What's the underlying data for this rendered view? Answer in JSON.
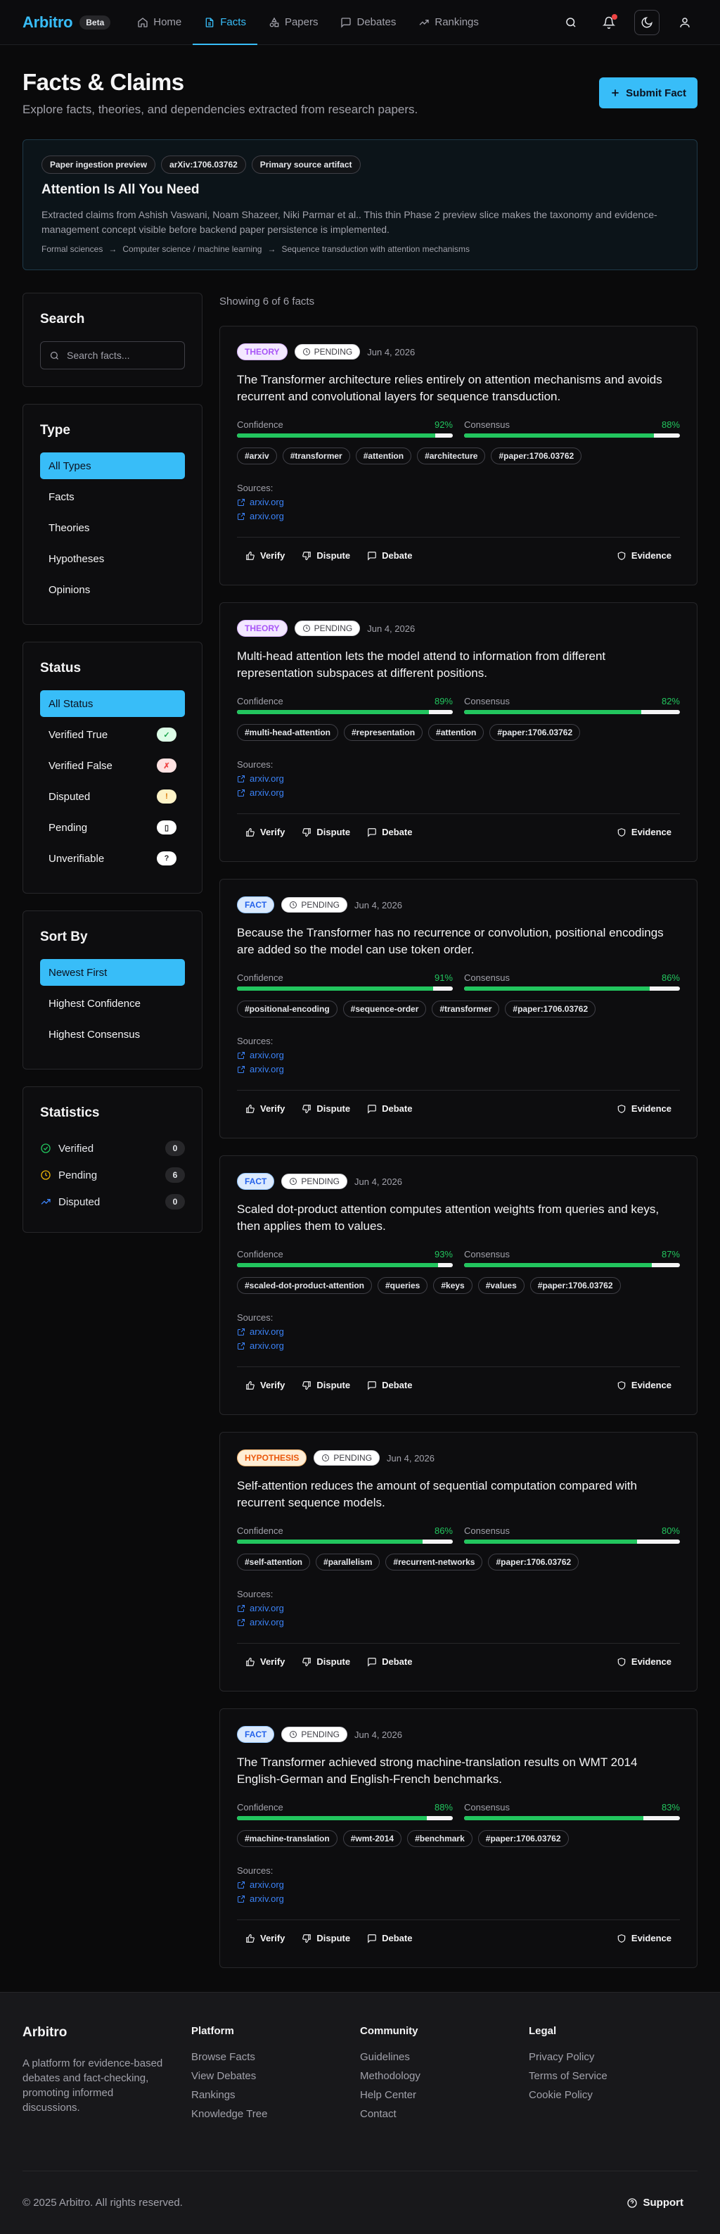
{
  "nav": {
    "brand": "Arbitro",
    "beta": "Beta",
    "links": [
      {
        "label": "Home",
        "icon": "home-icon"
      },
      {
        "label": "Facts",
        "icon": "document-icon",
        "active": true
      },
      {
        "label": "Papers",
        "icon": "shapes-icon"
      },
      {
        "label": "Debates",
        "icon": "chat-icon"
      },
      {
        "label": "Rankings",
        "icon": "trending-icon"
      }
    ]
  },
  "header": {
    "title": "Facts & Claims",
    "subtitle": "Explore facts, theories, and dependencies extracted from research papers.",
    "submit_label": "Submit Fact"
  },
  "preview": {
    "chips": [
      "Paper ingestion preview",
      "arXiv:1706.03762",
      "Primary source artifact"
    ],
    "title": "Attention Is All You Need",
    "description": "Extracted claims from Ashish Vaswani, Noam Shazeer, Niki Parmar et al.. This thin Phase 2 preview slice makes the taxonomy and evidence-management concept visible before backend paper persistence is implemented.",
    "crumbs": [
      "Formal sciences",
      "Computer science / machine learning",
      "Sequence transduction with attention mechanisms"
    ],
    "arrow": "→"
  },
  "sidebar": {
    "search": {
      "title": "Search",
      "placeholder": "Search facts..."
    },
    "type": {
      "title": "Type",
      "options": [
        "All Types",
        "Facts",
        "Theories",
        "Hypotheses",
        "Opinions"
      ]
    },
    "status": {
      "title": "Status",
      "options": [
        {
          "label": "All Status",
          "badge": ""
        },
        {
          "label": "Verified True",
          "badge": "✓"
        },
        {
          "label": "Verified False",
          "badge": "✗"
        },
        {
          "label": "Disputed",
          "badge": "!"
        },
        {
          "label": "Pending",
          "badge": "▯"
        },
        {
          "label": "Unverifiable",
          "badge": "?"
        }
      ]
    },
    "sort": {
      "title": "Sort By",
      "options": [
        "Newest First",
        "Highest Confidence",
        "Highest Consensus"
      ]
    },
    "stats": {
      "title": "Statistics",
      "rows": [
        {
          "label": "Verified",
          "count": "0"
        },
        {
          "label": "Pending",
          "count": "6"
        },
        {
          "label": "Disputed",
          "count": "0"
        }
      ]
    }
  },
  "main": {
    "showing": "Showing 6 of 6 facts",
    "labels": {
      "confidence": "Confidence",
      "consensus": "Consensus",
      "sources": "Sources:",
      "verify": "Verify",
      "dispute": "Dispute",
      "debate": "Debate",
      "evidence": "Evidence"
    },
    "facts": [
      {
        "type": "THEORY",
        "status": "PENDING",
        "date": "Jun 4, 2026",
        "text": "The Transformer architecture relies entirely on attention mechanisms and avoids recurrent and convolutional layers for sequence transduction.",
        "confidence": "92%",
        "confidence_value": 92,
        "consensus": "88%",
        "consensus_value": 88,
        "tags": [
          "#arxiv",
          "#transformer",
          "#attention",
          "#architecture",
          "#paper:1706.03762"
        ],
        "sources": [
          "arxiv.org",
          "arxiv.org"
        ]
      },
      {
        "type": "THEORY",
        "status": "PENDING",
        "date": "Jun 4, 2026",
        "text": "Multi-head attention lets the model attend to information from different representation subspaces at different positions.",
        "confidence": "89%",
        "confidence_value": 89,
        "consensus": "82%",
        "consensus_value": 82,
        "tags": [
          "#multi-head-attention",
          "#representation",
          "#attention",
          "#paper:1706.03762"
        ],
        "sources": [
          "arxiv.org",
          "arxiv.org"
        ]
      },
      {
        "type": "FACT",
        "status": "PENDING",
        "date": "Jun 4, 2026",
        "text": "Because the Transformer has no recurrence or convolution, positional encodings are added so the model can use token order.",
        "confidence": "91%",
        "confidence_value": 91,
        "consensus": "86%",
        "consensus_value": 86,
        "tags": [
          "#positional-encoding",
          "#sequence-order",
          "#transformer",
          "#paper:1706.03762"
        ],
        "sources": [
          "arxiv.org",
          "arxiv.org"
        ]
      },
      {
        "type": "FACT",
        "status": "PENDING",
        "date": "Jun 4, 2026",
        "text": "Scaled dot-product attention computes attention weights from queries and keys, then applies them to values.",
        "confidence": "93%",
        "confidence_value": 93,
        "consensus": "87%",
        "consensus_value": 87,
        "tags": [
          "#scaled-dot-product-attention",
          "#queries",
          "#keys",
          "#values",
          "#paper:1706.03762"
        ],
        "sources": [
          "arxiv.org",
          "arxiv.org"
        ]
      },
      {
        "type": "HYPOTHESIS",
        "status": "PENDING",
        "date": "Jun 4, 2026",
        "text": "Self-attention reduces the amount of sequential computation compared with recurrent sequence models.",
        "confidence": "86%",
        "confidence_value": 86,
        "consensus": "80%",
        "consensus_value": 80,
        "tags": [
          "#self-attention",
          "#parallelism",
          "#recurrent-networks",
          "#paper:1706.03762"
        ],
        "sources": [
          "arxiv.org",
          "arxiv.org"
        ]
      },
      {
        "type": "FACT",
        "status": "PENDING",
        "date": "Jun 4, 2026",
        "text": "The Transformer achieved strong machine-translation results on WMT 2014 English-German and English-French benchmarks.",
        "confidence": "88%",
        "confidence_value": 88,
        "consensus": "83%",
        "consensus_value": 83,
        "tags": [
          "#machine-translation",
          "#wmt-2014",
          "#benchmark",
          "#paper:1706.03762"
        ],
        "sources": [
          "arxiv.org",
          "arxiv.org"
        ]
      }
    ]
  },
  "footer": {
    "brand": "Arbitro",
    "description": "A platform for evidence-based debates and fact-checking, promoting informed discussions.",
    "columns": [
      {
        "title": "Platform",
        "links": [
          "Browse Facts",
          "View Debates",
          "Rankings",
          "Knowledge Tree"
        ]
      },
      {
        "title": "Community",
        "links": [
          "Guidelines",
          "Methodology",
          "Help Center",
          "Contact"
        ]
      },
      {
        "title": "Legal",
        "links": [
          "Privacy Policy",
          "Terms of Service",
          "Cookie Policy"
        ]
      }
    ],
    "copyright": "© 2025 Arbitro. All rights reserved.",
    "support": "Support"
  },
  "colors": {
    "accent": "#38bdf8",
    "success": "#22c55e",
    "link": "#3b82f6",
    "background": "#0a0a0b"
  }
}
